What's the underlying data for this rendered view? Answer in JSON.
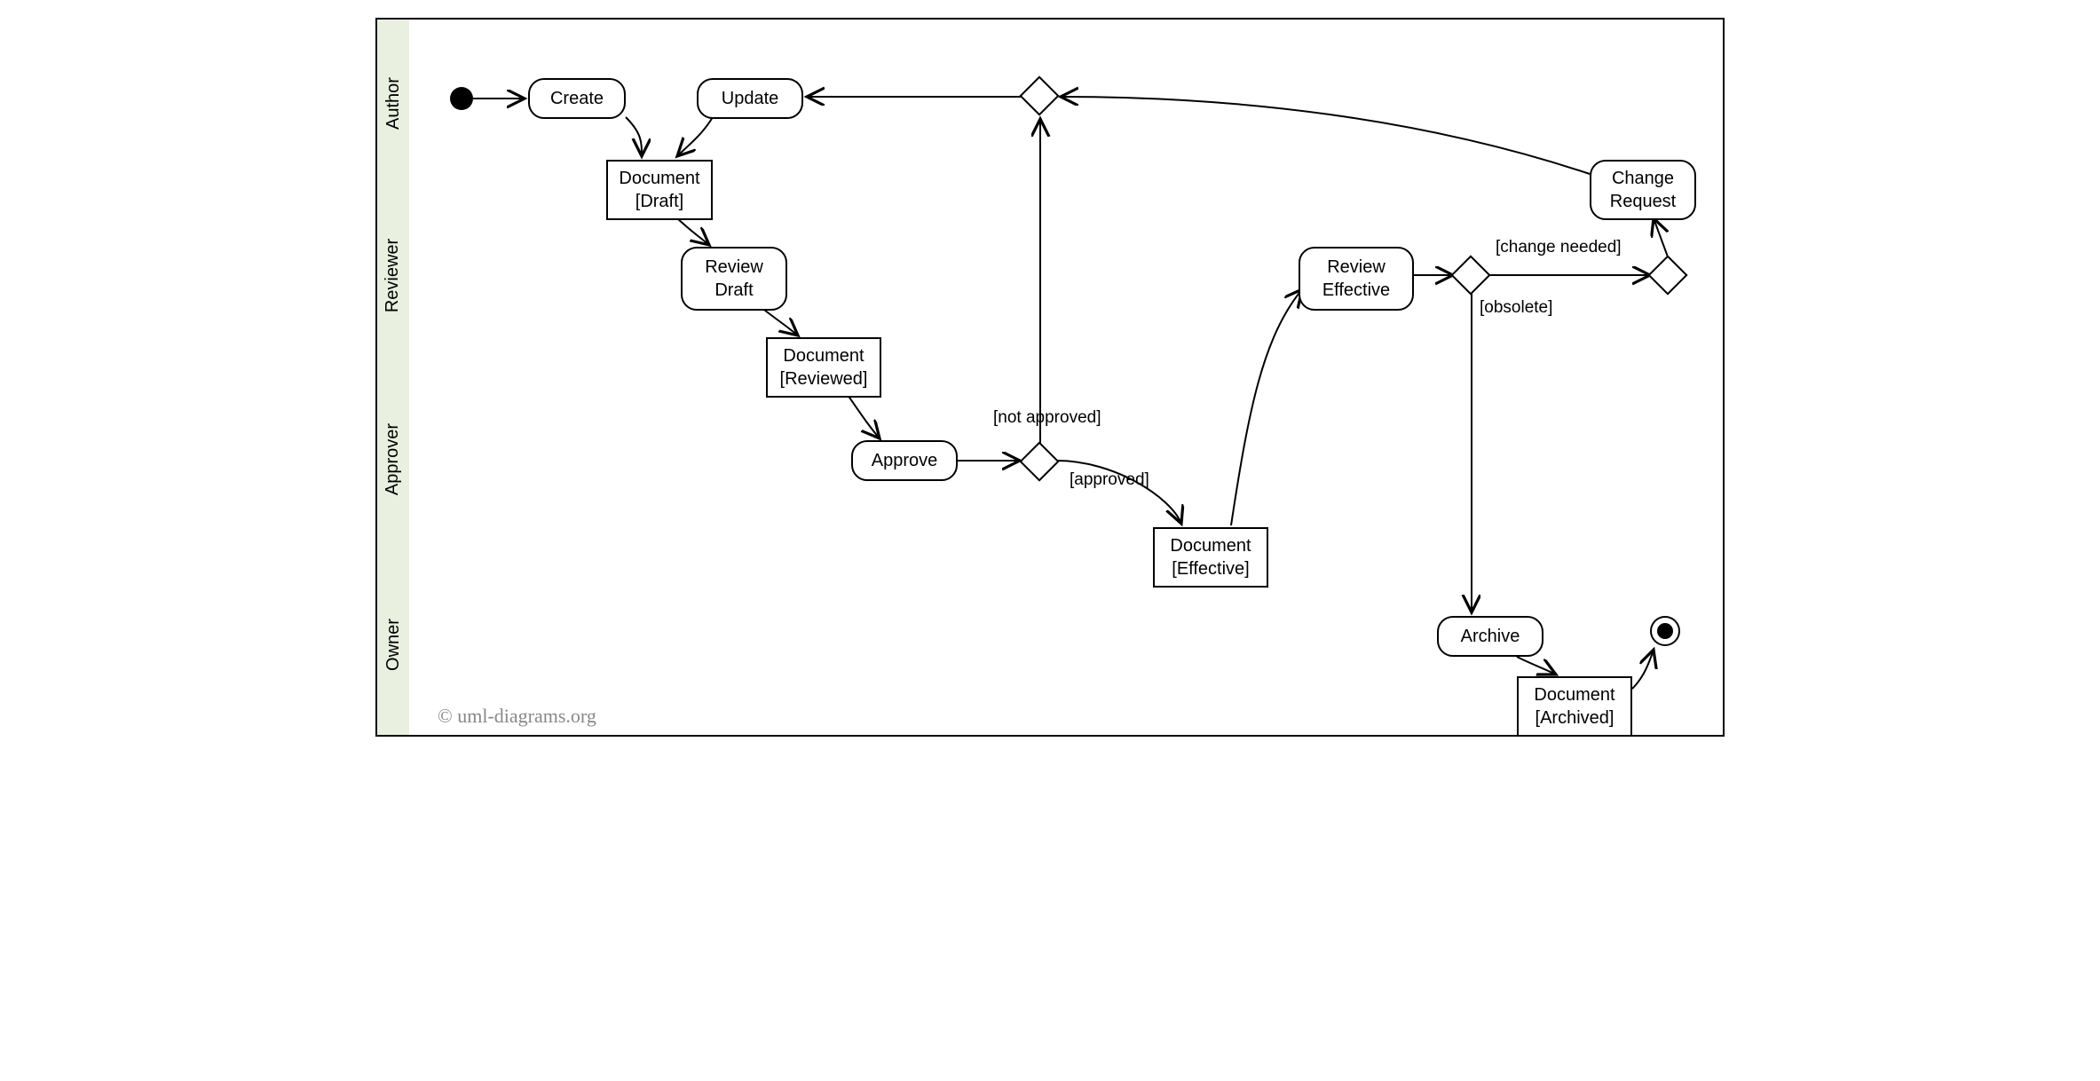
{
  "lanes": {
    "author": "Author",
    "reviewer": "Reviewer",
    "approver": "Approver",
    "owner": "Owner"
  },
  "activities": {
    "create": "Create",
    "update": "Update",
    "review_draft_l1": "Review",
    "review_draft_l2": "Draft",
    "approve": "Approve",
    "review_effective_l1": "Review",
    "review_effective_l2": "Effective",
    "change_request_l1": "Change",
    "change_request_l2": "Request",
    "archive": "Archive"
  },
  "objects": {
    "doc_draft_l1": "Document",
    "doc_draft_l2": "[Draft]",
    "doc_reviewed_l1": "Document",
    "doc_reviewed_l2": "[Reviewed]",
    "doc_effective_l1": "Document",
    "doc_effective_l2": "[Effective]",
    "doc_archived_l1": "Document",
    "doc_archived_l2": "[Archived]"
  },
  "guards": {
    "not_approved": "[not approved]",
    "approved": "[approved]",
    "change_needed": "[change needed]",
    "obsolete": "[obsolete]"
  },
  "copyright": "© uml-diagrams.org"
}
